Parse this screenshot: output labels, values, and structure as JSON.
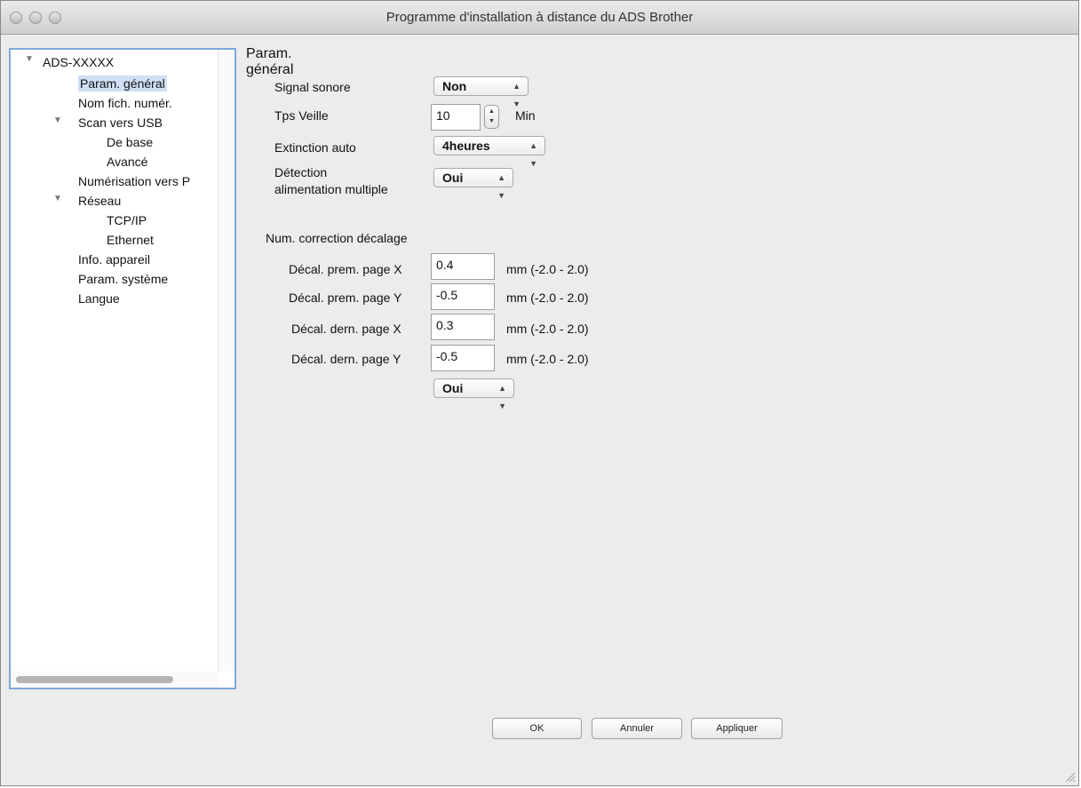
{
  "window": {
    "title": "Programme d'installation à distance du ADS Brother"
  },
  "tree": {
    "root": "ADS-XXXXX",
    "items": [
      "Param. général",
      "Nom fich. numér.",
      "Scan vers USB",
      "De base",
      "Avancé",
      "Numérisation vers P",
      "Réseau",
      "TCP/IP",
      "Ethernet",
      "Info. appareil",
      "Param. système",
      "Langue"
    ],
    "selected": "Param. général"
  },
  "panel": {
    "title": "Param. général",
    "signal_label": "Signal sonore",
    "signal_value": "Non",
    "sleep_label": "Tps Veille",
    "sleep_value": "10",
    "sleep_unit": "Min",
    "autooff_label": "Extinction auto",
    "autooff_value": "4heures",
    "multifeed_label_1": "Détection",
    "multifeed_label_2": "alimentation multiple",
    "multifeed_value": "Oui",
    "offset_section": "Num. correction décalage",
    "offsets": [
      {
        "label": "Décal. prem. page X",
        "value": "0.4",
        "range": "mm (-2.0 - 2.0)"
      },
      {
        "label": "Décal. prem. page Y",
        "value": "-0.5",
        "range": "mm (-2.0 - 2.0)"
      },
      {
        "label": "Décal. dern. page X",
        "value": "0.3",
        "range": "mm (-2.0 - 2.0)"
      },
      {
        "label": "Décal. dern. page Y",
        "value": "-0.5",
        "range": "mm (-2.0 - 2.0)"
      }
    ],
    "extra_value": "Oui"
  },
  "buttons": {
    "ok": "OK",
    "cancel": "Annuler",
    "apply": "Appliquer"
  },
  "icons": {
    "disclosure": "disclosure-triangle-icon",
    "popup_arrows": "popup-arrows-icon",
    "stepper": "stepper-arrows-icon",
    "resize": "resize-grip-icon"
  },
  "colors": {
    "selection": "#cfdff5",
    "focus_ring": "#7fa8d8"
  }
}
